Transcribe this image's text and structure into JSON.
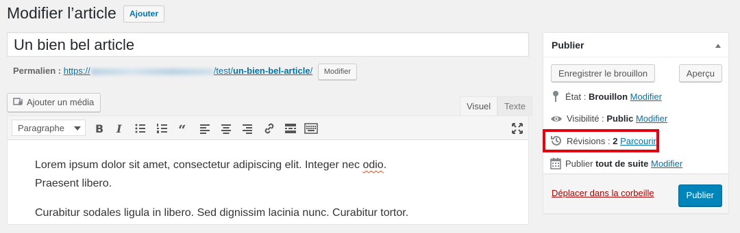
{
  "header": {
    "title": "Modifier l’article",
    "add_new": "Ajouter"
  },
  "post": {
    "title": "Un bien bel article"
  },
  "permalink": {
    "label": "Permalien :",
    "url_prefix": "https://",
    "url_path": "/test/",
    "slug": "un-bien-bel-article",
    "url_suffix": "/",
    "edit_label": "Modifier"
  },
  "media": {
    "add_media_label": "Ajouter un média"
  },
  "editor": {
    "tabs": {
      "visual": "Visuel",
      "text": "Texte"
    },
    "format_select": "Paragraphe",
    "toolbar_icons": [
      "bold-icon",
      "italic-icon",
      "bulleted-list-icon",
      "numbered-list-icon",
      "blockquote-icon",
      "align-left-icon",
      "align-center-icon",
      "align-right-icon",
      "link-icon",
      "read-more-icon",
      "toolbar-toggle-icon",
      "fullscreen-icon"
    ],
    "content": {
      "p1_line1_a": "Lorem ipsum dolor sit amet, consectetur adipiscing elit. Integer nec ",
      "p1_line1_b": "odio",
      "p1_line1_c": ".",
      "p1_line2": "Praesent libero.",
      "p2": "Curabitur sodales ligula in libero. Sed dignissim lacinia nunc. Curabitur tortor."
    }
  },
  "publish": {
    "title": "Publier",
    "save_draft": "Enregistrer le brouillon",
    "preview": "Aperçu",
    "status": {
      "label": "État :",
      "value": "Brouillon",
      "link": "Modifier"
    },
    "visibility": {
      "label": "Visibilité :",
      "value": "Public",
      "link": "Modifier"
    },
    "revisions": {
      "label": "Révisions :",
      "value": "2",
      "link": "Parcourir"
    },
    "schedule": {
      "label": "Publier",
      "value": "tout de suite",
      "link": "Modifier"
    },
    "trash": "Déplacer dans la corbeille",
    "publish_button": "Publier"
  },
  "colors": {
    "link": "#0073aa",
    "primary": "#0085ba",
    "highlight": "#e3000f",
    "trash": "#aa0000"
  }
}
